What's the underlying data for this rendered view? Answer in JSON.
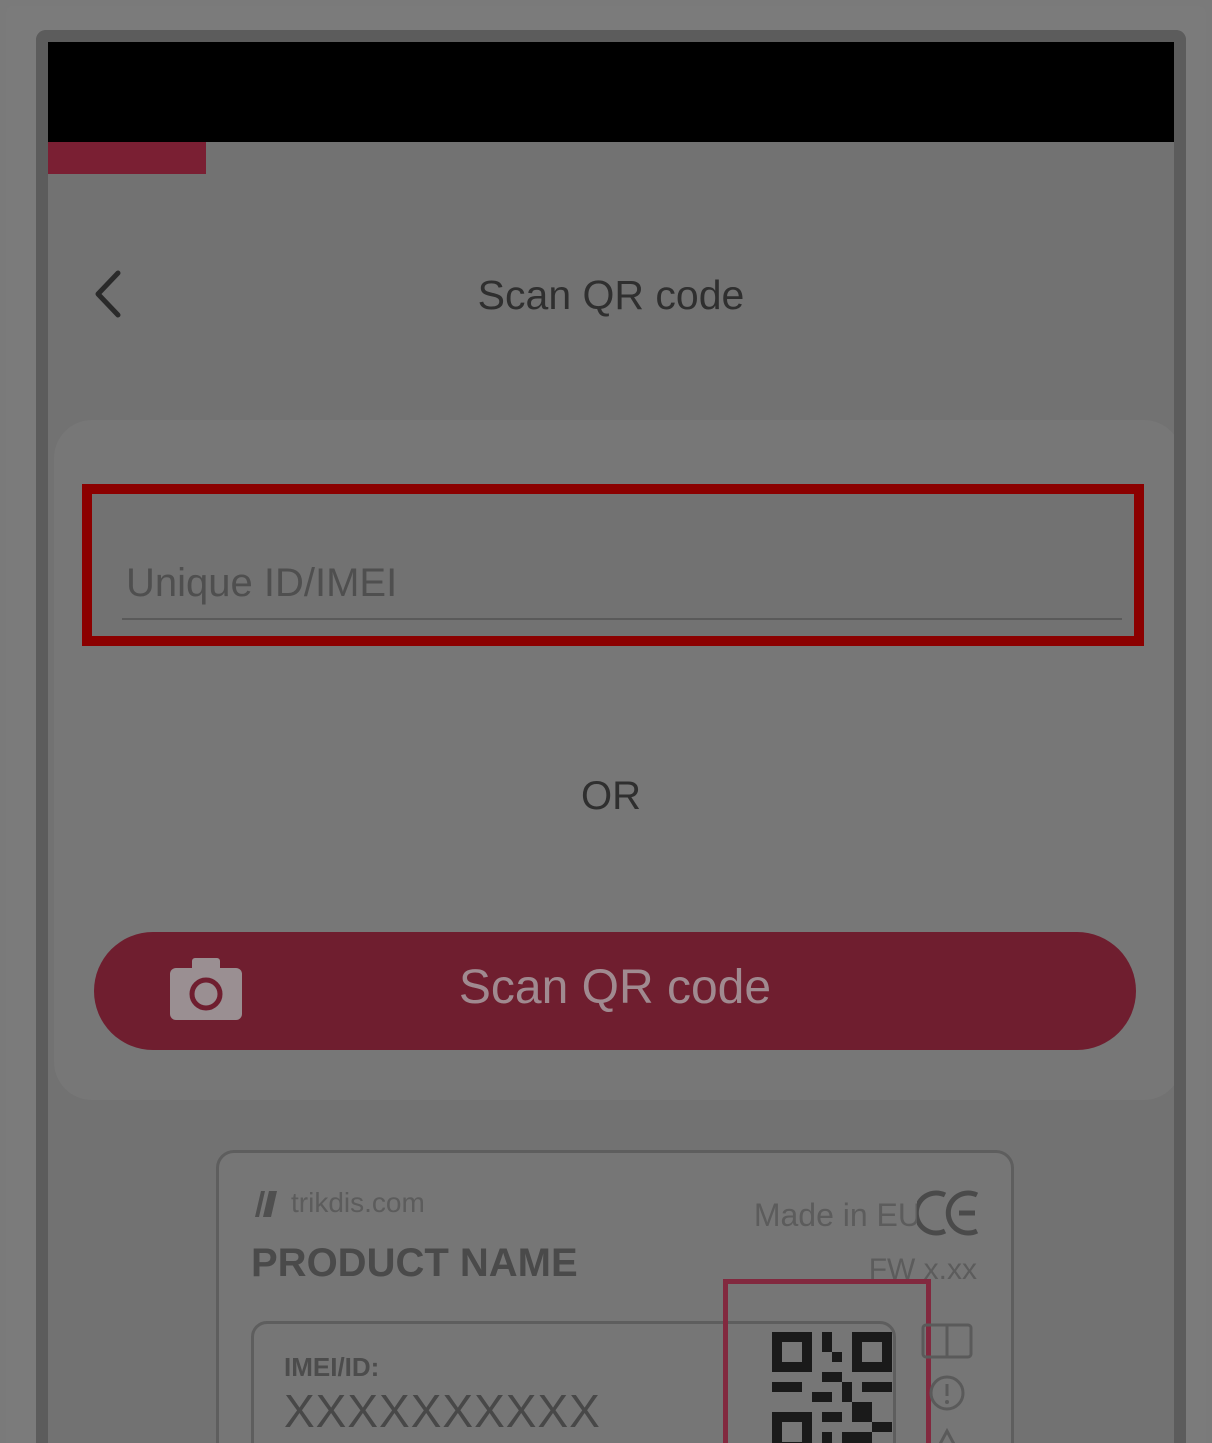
{
  "header": {
    "title": "Scan QR code"
  },
  "form": {
    "id_placeholder": "Unique ID/IMEI",
    "or_text": "OR",
    "scan_button_label": "Scan QR code"
  },
  "label_card": {
    "brand": "trikdis.com",
    "made_in": "Made in EU",
    "product_name": "PRODUCT NAME",
    "fw": "FW x.xx",
    "imei_label": "IMEI/ID:",
    "imei_value": "XXXXXXXXXX"
  },
  "colors": {
    "accent": "#6f1e2f",
    "highlight": "#8b0000"
  },
  "icons": {
    "back": "chevron-left-icon",
    "camera": "camera-icon",
    "qr": "qr-code-icon",
    "ce": "ce-mark-icon",
    "brand": "trikdis-logo-icon"
  }
}
